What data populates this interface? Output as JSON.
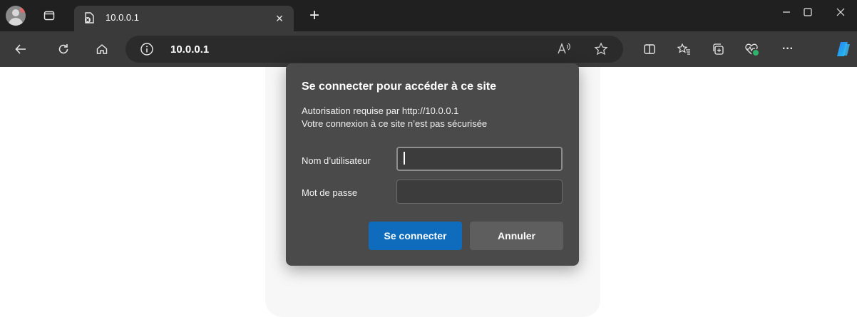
{
  "tab": {
    "title": "10.0.0.1",
    "close_glyph": "×"
  },
  "new_tab_glyph": "+",
  "address_bar": {
    "url": "10.0.0.1"
  },
  "toolbar": {
    "more_glyph": "···"
  },
  "dialog": {
    "title": "Se connecter pour accéder à ce site",
    "line1": "Autorisation requise par http://10.0.0.1",
    "line2": "Votre connexion à ce site n’est pas sécurisée",
    "username_label": "Nom d’utilisateur",
    "password_label": "Mot de passe",
    "username_value": "",
    "password_value": "",
    "submit_label": "Se connecter",
    "cancel_label": "Annuler"
  },
  "colors": {
    "tabstrip": "#202020",
    "toolbar": "#3a3a3a",
    "dialog": "#4a4a4a",
    "primary_button": "#0f6cbd",
    "secondary_button": "#5e5e5e"
  },
  "icons": [
    "profile-icon",
    "tab-actions-icon",
    "tab-favicon-icon",
    "back-icon",
    "refresh-icon",
    "home-icon",
    "info-icon",
    "read-aloud-icon",
    "favorite-star-icon",
    "split-screen-icon",
    "favorites-icon",
    "collections-icon",
    "performance-icon",
    "more-icon",
    "copilot-icon"
  ]
}
